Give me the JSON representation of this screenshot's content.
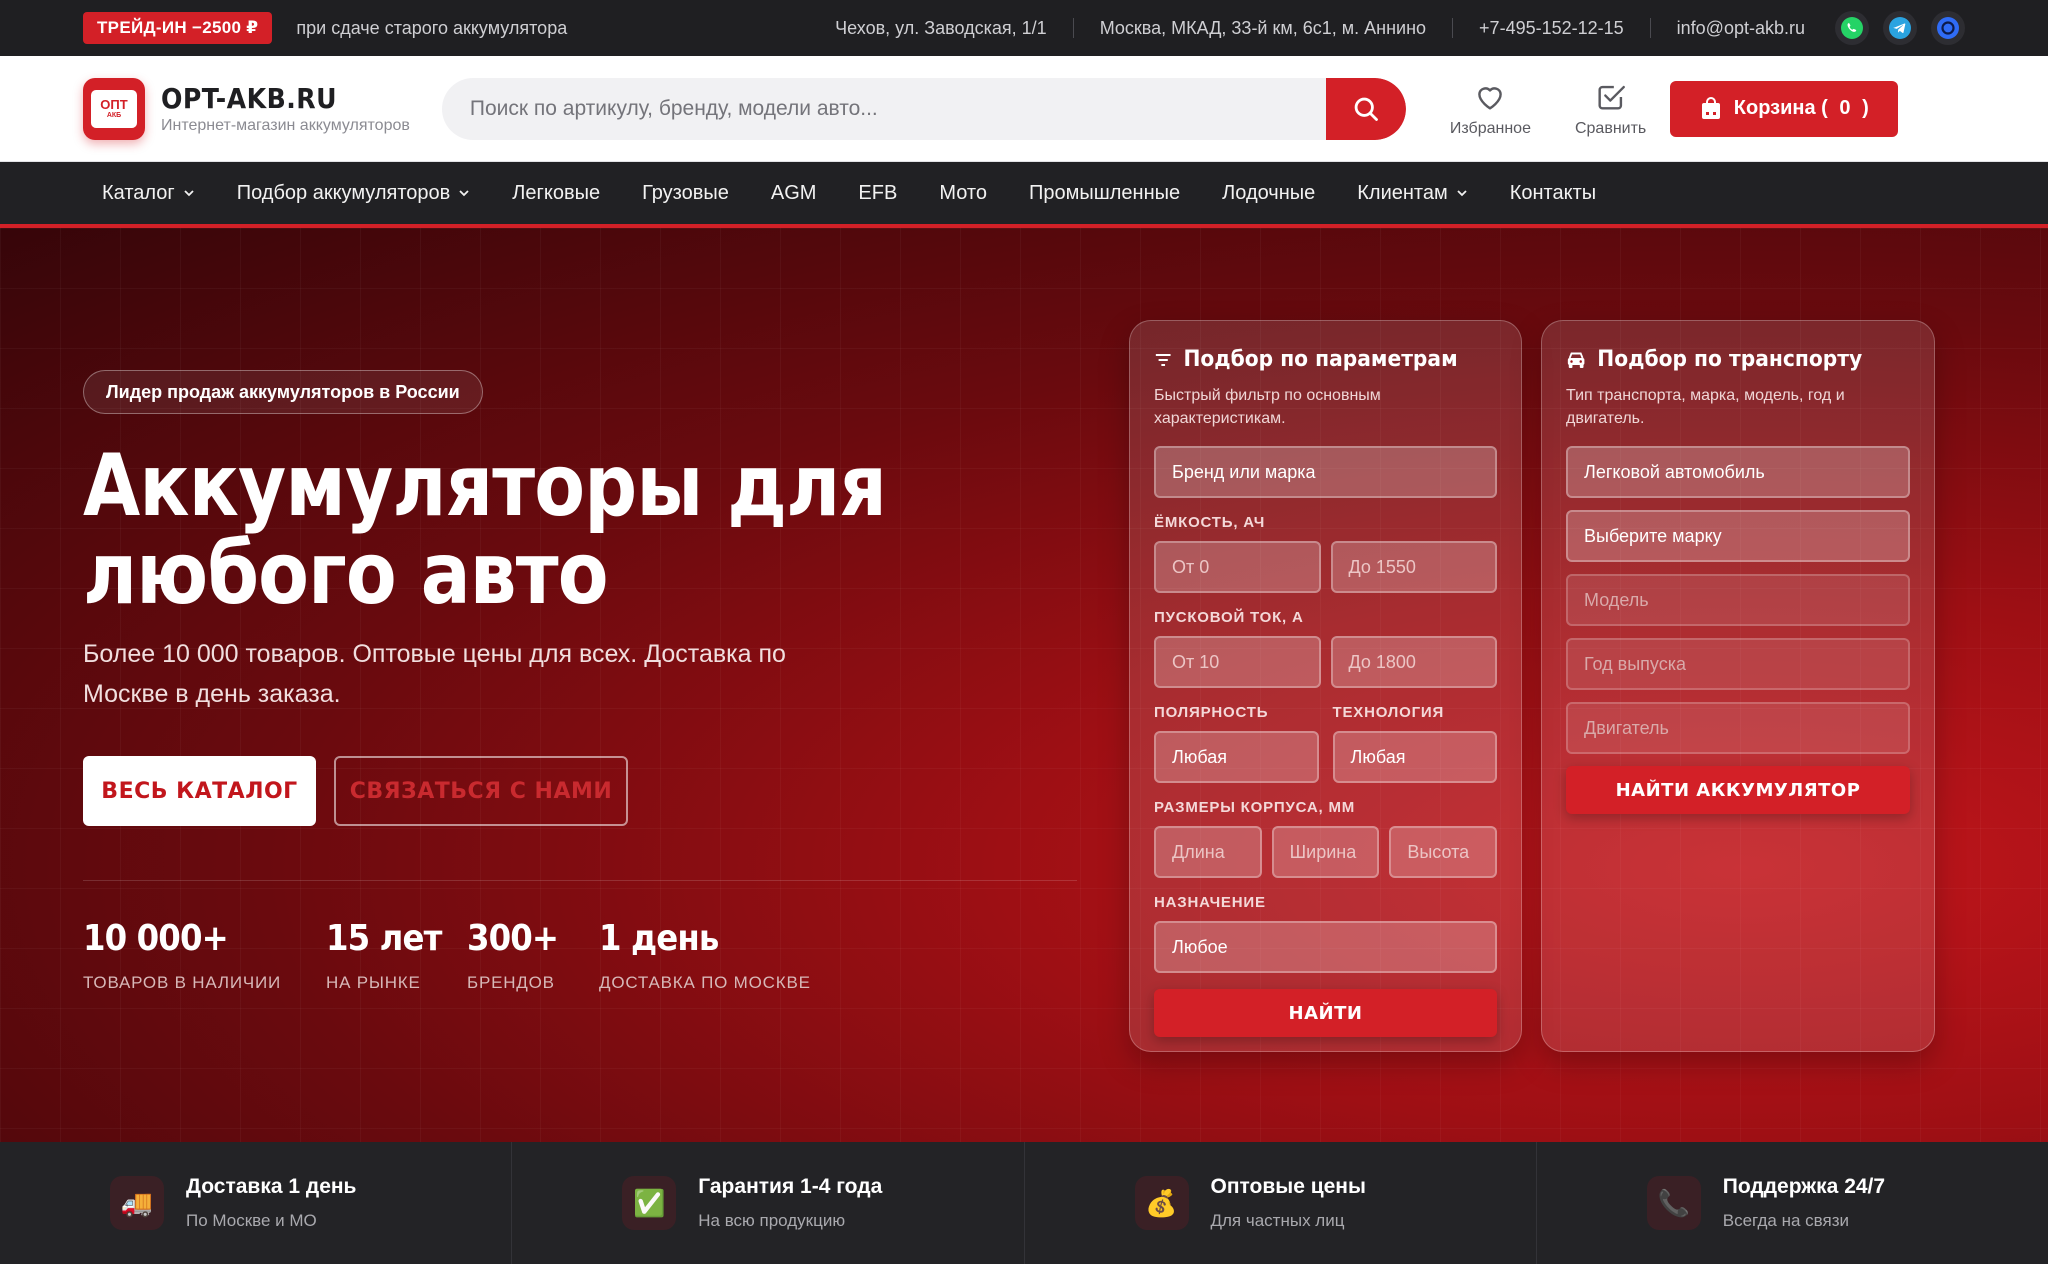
{
  "topbar": {
    "trade_badge": "ТРЕЙД-ИН −2500 ₽",
    "trade_text": "при сдаче старого аккумулятора",
    "address1": "Чехов, ул. Заводская, 1/1",
    "address2": "Москва, МКАД, 33-й км, 6с1, м. Аннино",
    "phone": "+7-495-152-12-15",
    "email": "info@opt-akb.ru",
    "social": [
      "whatsapp-icon",
      "telegram-icon",
      "max-icon"
    ]
  },
  "header": {
    "logo_mark_top": "ОПТ",
    "logo_mark_bottom": "АКБ",
    "logo_title": "OPT-AKB.RU",
    "logo_subtitle": "Интернет-магазин аккумуляторов",
    "search_placeholder": "Поиск по артикулу, бренду, модели авто...",
    "favorites_label": "Избранное",
    "compare_label": "Сравнить",
    "cart_label": "Корзина (",
    "cart_count": "0",
    "cart_close": ")"
  },
  "nav": {
    "items": [
      {
        "label": "Каталог",
        "dropdown": true
      },
      {
        "label": "Подбор аккумуляторов",
        "dropdown": true
      },
      {
        "label": "Легковые",
        "dropdown": false
      },
      {
        "label": "Грузовые",
        "dropdown": false
      },
      {
        "label": "AGM",
        "dropdown": false
      },
      {
        "label": "EFB",
        "dropdown": false
      },
      {
        "label": "Мото",
        "dropdown": false
      },
      {
        "label": "Промышленные",
        "dropdown": false
      },
      {
        "label": "Лодочные",
        "dropdown": false
      },
      {
        "label": "Клиентам",
        "dropdown": true
      },
      {
        "label": "Контакты",
        "dropdown": false
      }
    ]
  },
  "hero": {
    "badge": "Лидер продаж аккумуляторов в России",
    "title": "Аккумуляторы для любого авто",
    "description": "Более 10 000 товаров. Оптовые цены для всех. Доставка по Москве в день заказа.",
    "btn_catalog": "ВЕСЬ КАТАЛОГ",
    "btn_contact": "СВЯЗАТЬСЯ С НАМИ",
    "stats": [
      {
        "value": "10 000+",
        "label": "ТОВАРОВ В НАЛИЧИИ"
      },
      {
        "value": "15 лет",
        "label": "НА РЫНКЕ"
      },
      {
        "value": "300+",
        "label": "БРЕНДОВ"
      },
      {
        "value": "1 день",
        "label": "ДОСТАВКА ПО МОСКВЕ"
      }
    ]
  },
  "params_panel": {
    "title": "Подбор по параметрам",
    "subtitle": "Быстрый фильтр по основным характеристикам.",
    "brand_placeholder": "Бренд или марка",
    "capacity_label": "ЁМКОСТЬ, АЧ",
    "capacity_from": "От 0",
    "capacity_to": "До 1550",
    "current_label": "ПУСКОВОЙ ТОК, А",
    "current_from": "От 10",
    "current_to": "До 1800",
    "polarity_label": "ПОЛЯРНОСТЬ",
    "polarity_value": "Любая",
    "tech_label": "ТЕХНОЛОГИЯ",
    "tech_value": "Любая",
    "size_label": "РАЗМЕРЫ КОРПУСА, ММ",
    "size_length": "Длина",
    "size_width": "Ширина",
    "size_height": "Высота",
    "purpose_label": "НАЗНАЧЕНИЕ",
    "purpose_value": "Любое",
    "find_button": "НАЙТИ"
  },
  "vehicle_panel": {
    "title": "Подбор по транспорту",
    "subtitle": "Тип транспорта, марка, модель, год и двигатель.",
    "type_value": "Легковой автомобиль",
    "brand_placeholder": "Выберите марку",
    "model_placeholder": "Модель",
    "year_placeholder": "Год выпуска",
    "engine_placeholder": "Двигатель",
    "find_button": "НАЙТИ АККУМУЛЯТОР"
  },
  "features": [
    {
      "icon": "truck-icon",
      "title": "Доставка 1 день",
      "subtitle": "По Москве и МО"
    },
    {
      "icon": "check-icon",
      "title": "Гарантия 1-4 года",
      "subtitle": "На всю продукцию"
    },
    {
      "icon": "money-bag-icon",
      "title": "Оптовые цены",
      "subtitle": "Для частных лиц"
    },
    {
      "icon": "phone-icon",
      "title": "Поддержка 24/7",
      "subtitle": "Всегда на связи"
    }
  ],
  "colors": {
    "accent": "#d32027",
    "dark": "#1f1f22"
  }
}
